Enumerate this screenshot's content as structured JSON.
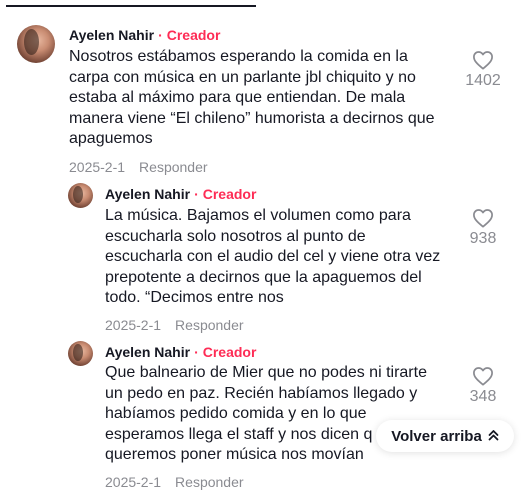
{
  "comments": [
    {
      "author": "Ayelen Nahir",
      "badge": "Creador",
      "text": "Nosotros estábamos esperando la comida en la\ncarpa con música en un parlante jbl chiquito y no\nestaba al máximo para que entiendan. De mala\nmanera viene “El chileno” humorista a decirnos que\napaguemos",
      "date": "2025-2-1",
      "reply": "Responder",
      "likes": "1402"
    },
    {
      "author": "Ayelen Nahir",
      "badge": "Creador",
      "text": "La música. Bajamos el volumen como para\nescucharla solo nosotros al punto de\nescucharla con el audio del cel y viene otra vez\nprepotente a decirnos que la apaguemos del\ntodo. “Decimos entre nos",
      "date": "2025-2-1",
      "reply": "Responder",
      "likes": "938"
    },
    {
      "author": "Ayelen Nahir",
      "badge": "Creador",
      "text": "Que balneario de Mier que no podes ni tirarte\nun pedo en paz. Recién habíamos llegado y\nhabíamos pedido comida y en lo que\nesperamos llega el staff y nos dicen q\nqueremos poner música nos movían",
      "date": "2025-2-1",
      "reply": "Responder",
      "likes": "348"
    }
  ],
  "back_to_top": {
    "label": "Volver arriba",
    "icon": "double-chevron-up-icon"
  },
  "icons": {
    "like": "heart-outline-icon"
  },
  "colors": {
    "creator_badge": "#fe2c55",
    "muted": "#8a8b91",
    "text": "#161823"
  }
}
